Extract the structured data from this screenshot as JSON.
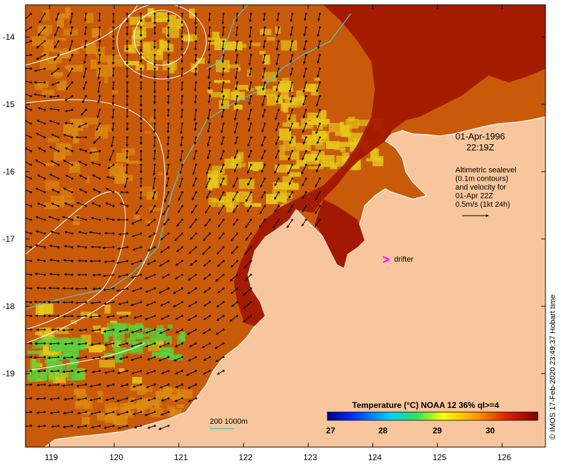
{
  "map": {
    "date": "01-Apr-1996",
    "time": "22:19Z",
    "legend_lines": [
      "Altimetric sealevel",
      "(0.1m contours)",
      "and velocity for",
      "01-Apr 22Z",
      "0.5m/s (1kt 24h)"
    ],
    "drifter_label": "drifter",
    "bathy_label": "200  1000m",
    "colorbar": {
      "title": "Temperature (°C) NOAA 12 36% ql>=4",
      "ticks": [
        "27",
        "28",
        "29",
        "30"
      ]
    },
    "x_ticks": [
      "119",
      "120",
      "121",
      "122",
      "123",
      "124",
      "125",
      "126"
    ],
    "y_ticks": [
      "-14",
      "-15",
      "-16",
      "-17",
      "-18",
      "-19"
    ],
    "credit": "© IMOS 17-Feb-2020 23:49:37 Hobart time",
    "colors": {
      "land": "#f8c69c",
      "sea_warm": "#c85a0a",
      "sea_hot": "#a31800",
      "sea_mid": "#dd8a10",
      "sea_cool": "#e6c81a",
      "sea_cold": "#5cd03a",
      "isobath": "#4fc9c3",
      "drifter": "#ff00ff"
    }
  }
}
